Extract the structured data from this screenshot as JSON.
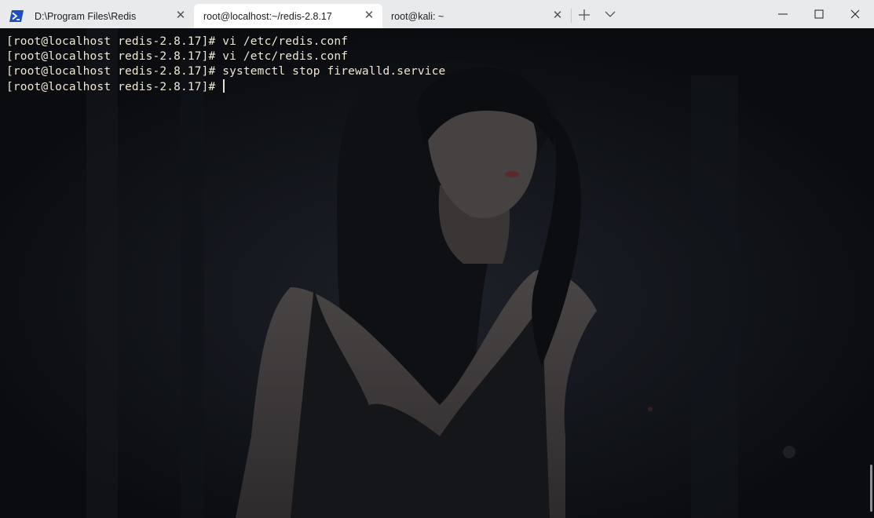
{
  "tabs": [
    {
      "label": "D:\\Program Files\\Redis",
      "icon": "powershell-icon",
      "active": false
    },
    {
      "label": "root@localhost:~/redis-2.8.17",
      "active": true
    },
    {
      "label": "root@kali: ~",
      "active": false
    }
  ],
  "window_controls": {
    "minimize": "minimize-icon",
    "maximize": "maximize-icon",
    "close": "close-icon"
  },
  "terminal": {
    "lines": [
      {
        "prompt": "[root@localhost redis-2.8.17]#",
        "command": " vi /etc/redis.conf"
      },
      {
        "prompt": "[root@localhost redis-2.8.17]#",
        "command": " vi /etc/redis.conf"
      },
      {
        "prompt": "[root@localhost redis-2.8.17]#",
        "command": " systemctl stop firewalld.service"
      },
      {
        "prompt": "[root@localhost redis-2.8.17]#",
        "command": " "
      }
    ]
  },
  "colors": {
    "tabbar_bg": "#e9eaec",
    "active_tab_bg": "#ffffff",
    "terminal_bg": "#0c0f13",
    "terminal_text": "#efe7d5",
    "powershell_blue": "#1f4fbd"
  }
}
